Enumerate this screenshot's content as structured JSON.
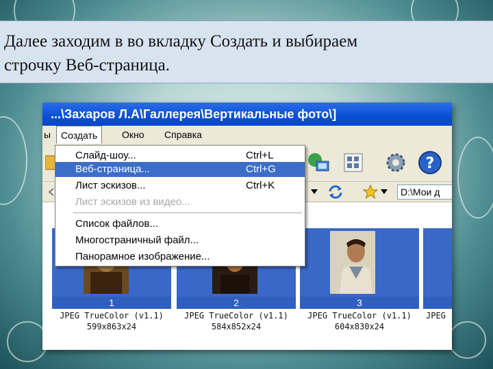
{
  "caption": {
    "line1": "Далее заходим в во вкладку Создать и выбираем",
    "line2": "строчку Веб-страница."
  },
  "window": {
    "title": "...\\Захаров Л.А\\Галлерея\\Вертикальные фото\\]",
    "menubar": {
      "left_partial": "ы",
      "items": [
        "Создать",
        "Окно",
        "Справка"
      ]
    },
    "address": "D:\\Мои д"
  },
  "dropdown": {
    "items": [
      {
        "label": "Слайд-шоу...",
        "shortcut": "Ctrl+L",
        "state": "normal"
      },
      {
        "label": "Веб-страница...",
        "shortcut": "Ctrl+G",
        "state": "highlighted"
      },
      {
        "label": "Лист эскизов...",
        "shortcut": "Ctrl+K",
        "state": "normal"
      },
      {
        "label": "Лист эскизов из видео...",
        "shortcut": "",
        "state": "disabled"
      },
      {
        "label": "Список файлов...",
        "shortcut": "",
        "state": "normal"
      },
      {
        "label": "Многостраничный файл...",
        "shortcut": "",
        "state": "normal"
      },
      {
        "label": "Панорамное изображение...",
        "shortcut": "",
        "state": "normal"
      }
    ]
  },
  "thumbnails": [
    {
      "number": "1",
      "format": "JPEG TrueColor (v1.1)",
      "dims": "599x863x24"
    },
    {
      "number": "2",
      "format": "JPEG TrueColor (v1.1)",
      "dims": "584x852x24"
    },
    {
      "number": "3",
      "format": "JPEG TrueColor (v1.1)",
      "dims": "604x830x24"
    },
    {
      "number": "",
      "format": "JPEG",
      "dims": ""
    }
  ],
  "colors": {
    "titlebar": "#0a4fd8",
    "menu_highlight": "#3c6ec9",
    "caption_bg": "#d8e3f0",
    "thumb_frame": "#3a68c8"
  },
  "icons": [
    "folder-icon",
    "network-icon",
    "grid-icon",
    "gear-icon",
    "help-icon",
    "refresh-icon",
    "favorites-star-icon"
  ]
}
